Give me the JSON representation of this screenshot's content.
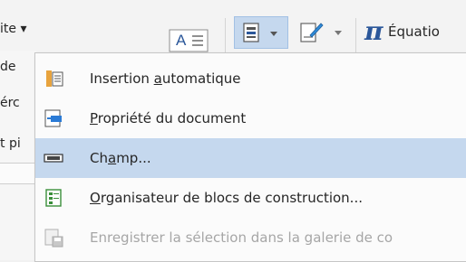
{
  "ribbon": {
    "left_partial": "ite ▾",
    "equation_symbol": "π",
    "equation_label": "Équatio",
    "textbox_caption": "A"
  },
  "left_edge": [
    "de",
    "érc",
    "t pi"
  ],
  "menu": {
    "items": [
      {
        "label_before": "Insertion ",
        "accel": "a",
        "label_after": "utomatique",
        "icon": "autotext-icon",
        "enabled": true,
        "highlighted": false
      },
      {
        "label_before": "",
        "accel": "P",
        "label_after": "ropriété du document",
        "icon": "document-property-icon",
        "enabled": true,
        "highlighted": false
      },
      {
        "label_before": "Ch",
        "accel": "a",
        "label_after": "mp...",
        "icon": "field-icon",
        "enabled": true,
        "highlighted": true
      },
      {
        "label_before": "",
        "accel": "O",
        "label_after": "rganisateur de blocs de construction...",
        "icon": "building-blocks-organizer-icon",
        "enabled": true,
        "highlighted": false
      },
      {
        "label_before": "Enregistrer la sélection dans la galerie de co",
        "accel": "",
        "label_after": "",
        "icon": "save-to-gallery-icon",
        "enabled": false,
        "highlighted": false
      }
    ]
  }
}
